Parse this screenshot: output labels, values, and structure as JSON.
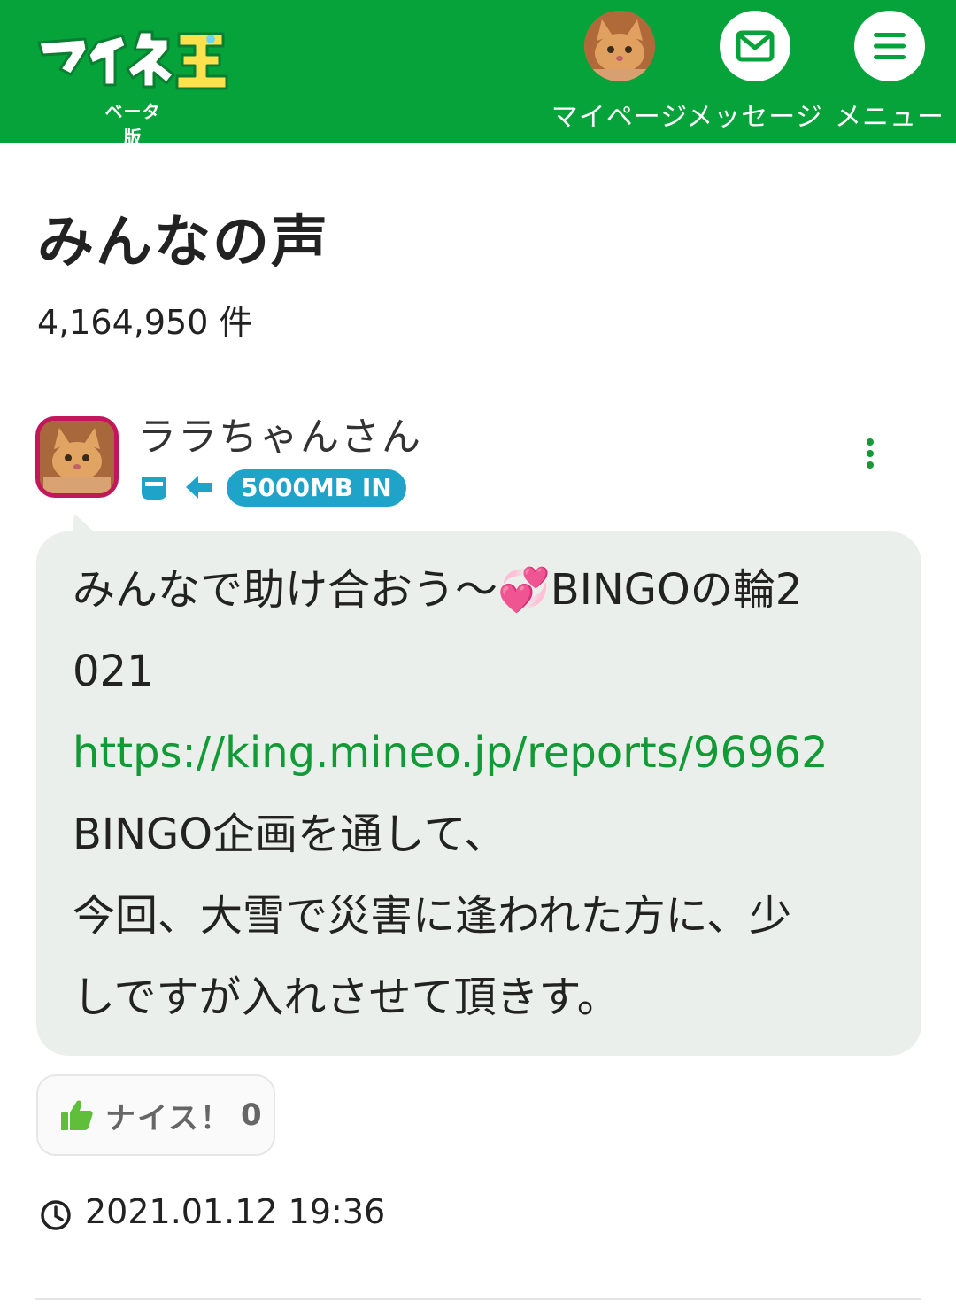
{
  "header": {
    "logo_text": "マイネ王",
    "logo_sub": "ベータ版",
    "nav": {
      "mypage_label": "マイページ",
      "message_label": "メッセージ",
      "menu_label": "メニュー"
    }
  },
  "page": {
    "title": "みんなの声",
    "count": "4,164,950 件"
  },
  "post": {
    "username": "ララちゃんさん",
    "badge": "5000MB IN",
    "body_lines": [
      "みんなで助け合おう～💞BINGOの輪2",
      "021",
      "https://king.mineo.jp/reports/96962",
      "BINGO企画を通して、",
      "今回、大雪で災害に逢われた方に、少",
      "しですが入れさせて頂きす。"
    ],
    "nice_label": "ナイス！",
    "nice_count": "0",
    "timestamp": "2021.01.12 19:36"
  },
  "colors": {
    "brand_green": "#05a33a",
    "link_green": "#119a35",
    "badge_blue": "#1fa3c8",
    "avatar_border": "#c2185b",
    "bubble_bg": "#ebefeb"
  },
  "icons": [
    "cat-avatar-icon",
    "envelope-icon",
    "hamburger-menu-icon",
    "cup-icon",
    "arrow-left-icon",
    "more-vertical-icon",
    "thumbs-up-icon",
    "clock-icon"
  ]
}
